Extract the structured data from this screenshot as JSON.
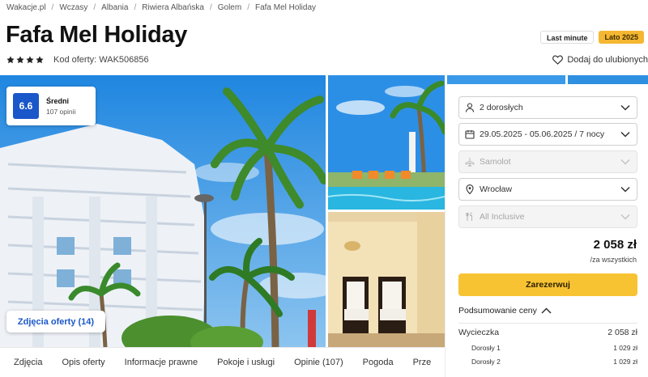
{
  "breadcrumb": [
    "Wakacje.pl",
    "Wczasy",
    "Albania",
    "Riwiera Albańska",
    "Golem",
    "Fafa Mel Holiday"
  ],
  "hotel": {
    "name": "Fafa Mel Holiday",
    "stars": 4,
    "offer_code": "Kod oferty: WAK506856"
  },
  "badges": {
    "last_minute": "Last minute",
    "season": "Lato 2025"
  },
  "favorite": {
    "label": "Dodaj do ulubionych",
    "icon": "heart-icon"
  },
  "rating": {
    "score": "6.6",
    "label": "Średni",
    "count": "107 opinii"
  },
  "gallery": {
    "photos_button": "Zdjęcia oferty (14)"
  },
  "booking": {
    "travelers": {
      "value": "2 dorosłych",
      "icon": "person-icon"
    },
    "dates": {
      "value": "29.05.2025 - 05.06.2025 / 7 nocy",
      "icon": "calendar-icon"
    },
    "transport": {
      "value": "Samolot",
      "icon": "plane-icon",
      "disabled": true
    },
    "departure": {
      "value": "Wrocław",
      "icon": "location-pin-icon"
    },
    "board": {
      "value": "All Inclusive",
      "icon": "cutlery-icon",
      "disabled": true
    },
    "price": "2 058 zł",
    "price_note": "/za wszystkich",
    "book_label": "Zarezerwuj",
    "summary_label": "Podsumowanie ceny",
    "summary": {
      "trip_label": "Wycieczka",
      "trip_value": "2 058 zł",
      "items": [
        {
          "label": "Dorosły 1",
          "value": "1 029 zł"
        },
        {
          "label": "Dorosły 2",
          "value": "1 029 zł"
        }
      ]
    }
  },
  "tabs": [
    "Zdjęcia",
    "Opis oferty",
    "Informacje prawne",
    "Pokoje i usługi",
    "Opinie (107)",
    "Pogoda",
    "Prze"
  ],
  "colors": {
    "accent": "#1a57c9",
    "book": "#f8c333",
    "season_badge": "#f5b731"
  }
}
